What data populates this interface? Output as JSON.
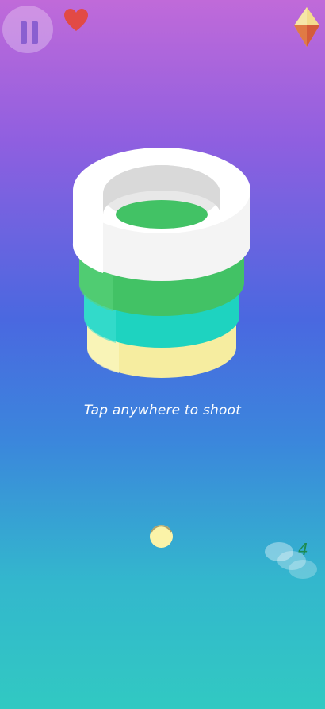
{
  "hud": {
    "pause_icon": "pause-icon",
    "lives_icon": "heart-icon",
    "gems_icon": "gem-icon"
  },
  "tower": {
    "rings_top_to_bottom": [
      "white",
      "green",
      "teal",
      "yellow"
    ],
    "colors": {
      "white": "#ffffff",
      "green": "#42c265",
      "teal": "#1fd6c4",
      "yellow": "#fbf3a8"
    }
  },
  "hint": {
    "text": "Tap anywhere to shoot"
  },
  "ball": {
    "color": "#fbf3a8"
  },
  "ammo": {
    "count": "4"
  },
  "colors": {
    "bg_top": "#c06ad9",
    "bg_mid": "#4a68e0",
    "bg_bottom": "#31c9c2",
    "heart": "#e24a45"
  }
}
